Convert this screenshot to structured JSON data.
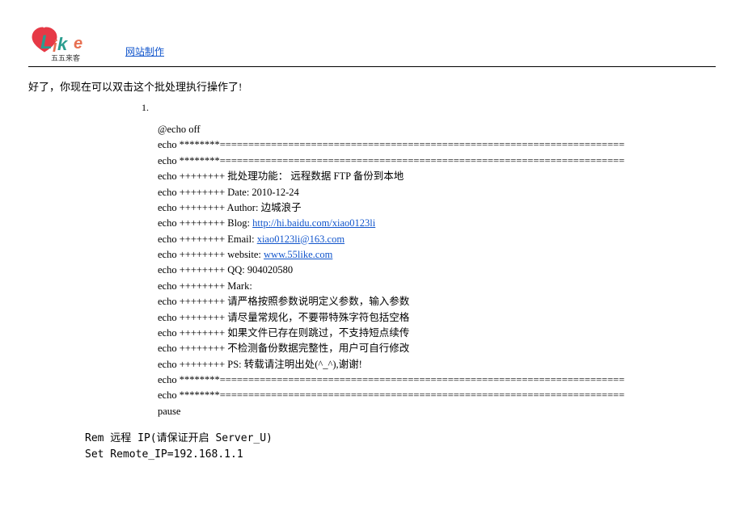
{
  "header": {
    "logo_sub": "五五来客",
    "link_label": "网站制作"
  },
  "intro": "好了，你现在可以双击这个批处理执行操作了!",
  "list_number": "1.",
  "code": {
    "l0": "@echo off",
    "l1": "echo ********=======================================================================",
    "l2": "echo ********=======================================================================",
    "l3_prefix": "echo ++++++++    批处理功能：  远程数据 FTP 备份到本地",
    "l4": "echo ++++++++    Date:   2010-12-24",
    "l5": "echo ++++++++    Author:    边城浪子",
    "l6_prefix": "echo ++++++++    Blog:   ",
    "l6_link": "http://hi.baidu.com/xiao0123li",
    "l7_prefix": "echo ++++++++    Email:   ",
    "l7_link": "xiao0123li@163.com",
    "l8_prefix": "echo ++++++++    website:   ",
    "l8_link": "www.55like.com",
    "l9": "echo ++++++++    QQ:     904020580",
    "l10": "echo ++++++++    Mark:",
    "l11": "echo ++++++++       请严格按照参数说明定义参数，输入参数",
    "l12": "echo ++++++++       请尽量常规化，不要带特殊字符包括空格",
    "l13": "echo ++++++++       如果文件已存在则跳过，不支持短点续传",
    "l14": "echo ++++++++       不检测备份数据完整性，用户可自行修改",
    "l15": "echo ++++++++    PS:    转载请注明出处(^_^),谢谢!",
    "l16": "echo ********=======================================================================",
    "l17": "echo ********=======================================================================",
    "l18": "pause"
  },
  "footer": {
    "l0": "Rem 远程 IP(请保证开启 Server_U)",
    "l1": "Set Remote_IP=192.168.1.1"
  }
}
